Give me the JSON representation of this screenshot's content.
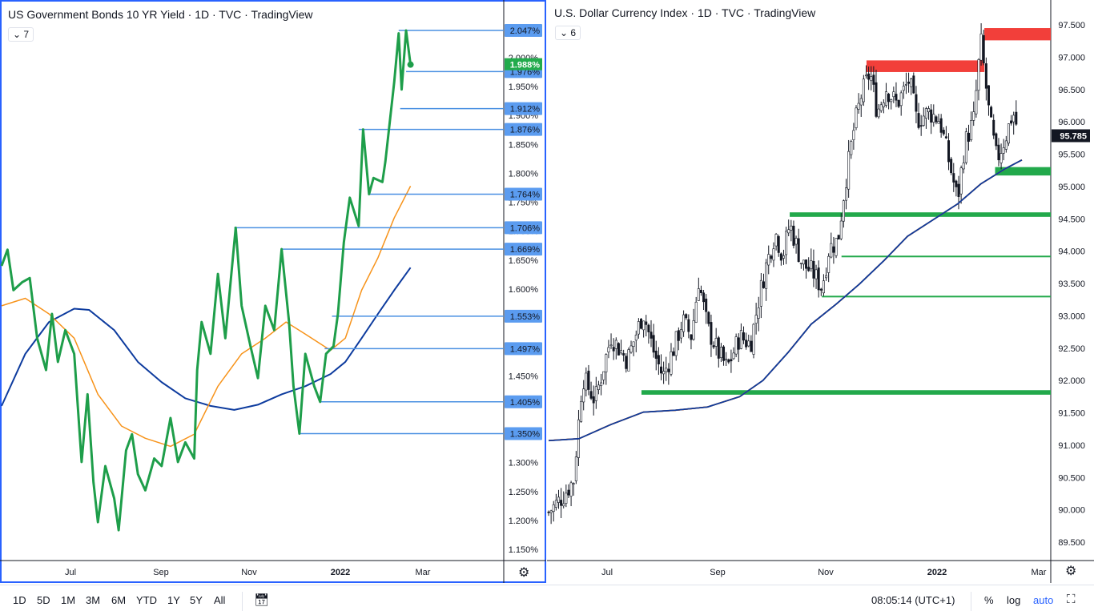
{
  "left": {
    "title": "US Government Bonds 10 YR Yield · 1D · TVC · TradingView",
    "legend_count": "7",
    "time_labels": [
      "Jul",
      "Sep",
      "Nov",
      "2022",
      "Mar"
    ],
    "price_ticks": [
      "2.000%",
      "1.950%",
      "1.900%",
      "1.850%",
      "1.800%",
      "1.750%",
      "1.700%",
      "1.650%",
      "1.600%",
      "1.550%",
      "1.500%",
      "1.450%",
      "1.400%",
      "1.350%",
      "1.300%",
      "1.250%",
      "1.200%",
      "1.150%"
    ],
    "current_price": "1.988%",
    "level_labels": [
      "2.047%",
      "1.976%",
      "1.912%",
      "1.876%",
      "1.764%",
      "1.706%",
      "1.669%",
      "1.553%",
      "1.497%",
      "1.405%",
      "1.350%"
    ]
  },
  "right": {
    "title": "U.S. Dollar Currency Index · 1D · TVC · TradingView",
    "legend_count": "6",
    "time_labels": [
      "Jul",
      "Sep",
      "Nov",
      "2022",
      "Mar"
    ],
    "price_ticks": [
      "97.500",
      "97.000",
      "96.500",
      "96.000",
      "95.500",
      "95.000",
      "94.500",
      "94.000",
      "93.500",
      "93.000",
      "92.500",
      "92.000",
      "91.500",
      "91.000",
      "90.500",
      "90.000",
      "89.500"
    ],
    "current_price": "95.785"
  },
  "toolbar": {
    "ranges": [
      "1D",
      "5D",
      "1M",
      "3M",
      "6M",
      "YTD",
      "1Y",
      "5Y",
      "All"
    ],
    "clock": "08:05:14 (UTC+1)",
    "percent": "%",
    "log": "log",
    "auto": "auto"
  },
  "colors": {
    "yield": "#1e9e4a",
    "ma_fast": "#f7931a",
    "ma_slow": "#0d3b9e",
    "level": "#4a90e2",
    "label_bg": "#5b9cf0",
    "resistance": "#f23f3a",
    "support": "#22a94b"
  },
  "chart_data": [
    {
      "type": "line",
      "name": "US10Y",
      "ylim": [
        1.15,
        2.0
      ],
      "series": [
        {
          "name": "yield",
          "x_days": [
            0,
            4,
            8,
            14,
            19,
            24,
            30,
            34,
            38,
            43,
            49,
            54,
            58,
            62,
            65,
            70,
            76,
            79,
            84,
            88,
            92,
            97,
            103,
            108,
            114,
            119,
            124,
            130,
            132,
            135,
            141,
            146,
            151,
            158,
            162,
            168,
            173,
            178,
            184,
            189,
            194,
            197,
            201,
            205,
            211,
            215,
            219,
            224,
            227,
            231,
            235,
            241,
            244,
            248,
            251,
            257,
            259,
            262,
            265,
            268,
            270,
            273,
            276
          ],
          "values": [
            1.64,
            1.668,
            1.598,
            1.612,
            1.619,
            1.515,
            1.46,
            1.557,
            1.474,
            1.529,
            1.488,
            1.301,
            1.418,
            1.266,
            1.197,
            1.294,
            1.238,
            1.183,
            1.321,
            1.349,
            1.28,
            1.252,
            1.307,
            1.294,
            1.377,
            1.301,
            1.335,
            1.307,
            1.46,
            1.543,
            1.488,
            1.626,
            1.515,
            1.706,
            1.571,
            1.501,
            1.446,
            1.571,
            1.529,
            1.669,
            1.543,
            1.432,
            1.35,
            1.488,
            1.432,
            1.405,
            1.488,
            1.501,
            1.557,
            1.681,
            1.758,
            1.709,
            1.876,
            1.764,
            1.792,
            1.785,
            1.82,
            1.889,
            1.958,
            2.042,
            1.945,
            2.047,
            1.988
          ]
        },
        {
          "name": "ma_fast",
          "x_days": [
            0,
            16,
            32,
            49,
            65,
            81,
            97,
            114,
            130,
            146,
            162,
            178,
            192,
            205,
            222,
            232,
            243,
            254,
            265,
            276
          ],
          "values": [
            1.571,
            1.584,
            1.557,
            1.515,
            1.418,
            1.363,
            1.342,
            1.328,
            1.349,
            1.432,
            1.488,
            1.515,
            1.543,
            1.522,
            1.494,
            1.515,
            1.598,
            1.654,
            1.723,
            1.778
          ]
        },
        {
          "name": "ma_slow",
          "x_days": [
            0,
            16,
            32,
            49,
            59,
            76,
            92,
            108,
            124,
            141,
            157,
            173,
            189,
            205,
            222,
            232,
            243,
            254,
            265,
            276
          ],
          "values": [
            1.398,
            1.488,
            1.543,
            1.566,
            1.564,
            1.529,
            1.474,
            1.439,
            1.411,
            1.398,
            1.391,
            1.4,
            1.418,
            1.432,
            1.453,
            1.474,
            1.515,
            1.557,
            1.598,
            1.637
          ]
        }
      ],
      "levels": [
        {
          "value": 2.047,
          "from_day": 268
        },
        {
          "value": 1.976,
          "from_day": 273
        },
        {
          "value": 1.912,
          "from_day": 269
        },
        {
          "value": 1.876,
          "from_day": 241
        },
        {
          "value": 1.764,
          "from_day": 248
        },
        {
          "value": 1.706,
          "from_day": 157
        },
        {
          "value": 1.669,
          "from_day": 189
        },
        {
          "value": 1.553,
          "from_day": 223
        },
        {
          "value": 1.497,
          "from_day": 218
        },
        {
          "value": 1.405,
          "from_day": 215
        },
        {
          "value": 1.35,
          "from_day": 201
        }
      ]
    },
    {
      "type": "candlestick",
      "name": "DXY",
      "ylim": [
        89.5,
        97.5
      ],
      "close_path": {
        "x_days": [
          0,
          8,
          14,
          19,
          26,
          35,
          44,
          53,
          59,
          64,
          71,
          75,
          80,
          84,
          89,
          95,
          100,
          107,
          113,
          118,
          122,
          127,
          131,
          135,
          142,
          148,
          153,
          157,
          162,
          166,
          171,
          175,
          180,
          184,
          189,
          195,
          202,
          206,
          213,
          219,
          224,
          229,
          233,
          238,
          242,
          247,
          251,
          256,
          260,
          263
        ],
        "values": [
          89.96,
          90.21,
          90.46,
          92.06,
          91.69,
          92.68,
          92.31,
          93.05,
          92.43,
          92.06,
          92.56,
          92.93,
          92.68,
          93.55,
          92.81,
          92.43,
          92.19,
          92.68,
          92.56,
          93.3,
          93.8,
          94.29,
          93.92,
          94.42,
          93.8,
          93.67,
          93.43,
          94.04,
          94.17,
          95.04,
          95.9,
          96.4,
          96.77,
          96.15,
          96.52,
          96.27,
          96.65,
          96.03,
          96.15,
          96.03,
          95.41,
          94.79,
          95.66,
          96.03,
          97.26,
          96.03,
          95.41,
          95.78,
          96.15,
          95.85
        ]
      },
      "series": [
        {
          "name": "ma_fast",
          "x_days": [
            0,
            8,
            14,
            26,
            39,
            53,
            66,
            80,
            93,
            107,
            120,
            134,
            147,
            161,
            174,
            188,
            201,
            215,
            229,
            242,
            256,
            265
          ],
          "values": [
            90.79,
            90.58,
            90.64,
            91.13,
            91.57,
            91.94,
            92.06,
            92.31,
            92.43,
            92.56,
            92.93,
            93.43,
            93.36,
            93.67,
            94.29,
            94.79,
            95.28,
            95.59,
            95.66,
            95.84,
            95.78,
            95.8
          ]
        },
        {
          "name": "ma_slow",
          "x_days": [
            0,
            17,
            35,
            53,
            71,
            89,
            107,
            120,
            134,
            147,
            161,
            174,
            188,
            201,
            215,
            229,
            242,
            256,
            265
          ],
          "values": [
            91.07,
            91.1,
            91.32,
            91.51,
            91.54,
            91.59,
            91.75,
            92.0,
            92.43,
            92.87,
            93.18,
            93.49,
            93.86,
            94.23,
            94.48,
            94.73,
            95.04,
            95.28,
            95.41
          ]
        }
      ],
      "zones": [
        {
          "kind": "resistance",
          "low": 96.77,
          "high": 96.95,
          "from_day": 178,
          "to_day": 244
        },
        {
          "kind": "resistance",
          "low": 97.26,
          "high": 97.45,
          "from_day": 244,
          "to_day": null
        },
        {
          "kind": "support",
          "low": 95.17,
          "high": 95.3,
          "from_day": 250,
          "to_day": null
        },
        {
          "kind": "support",
          "low": 94.53,
          "high": 94.6,
          "from_day": 135,
          "to_day": null
        },
        {
          "kind": "support",
          "low": 93.91,
          "high": 93.93,
          "from_day": 164,
          "to_day": null
        },
        {
          "kind": "support",
          "low": 93.29,
          "high": 93.31,
          "from_day": 153,
          "to_day": null
        },
        {
          "kind": "support",
          "low": 91.78,
          "high": 91.85,
          "from_day": 52,
          "to_day": null
        }
      ]
    }
  ]
}
